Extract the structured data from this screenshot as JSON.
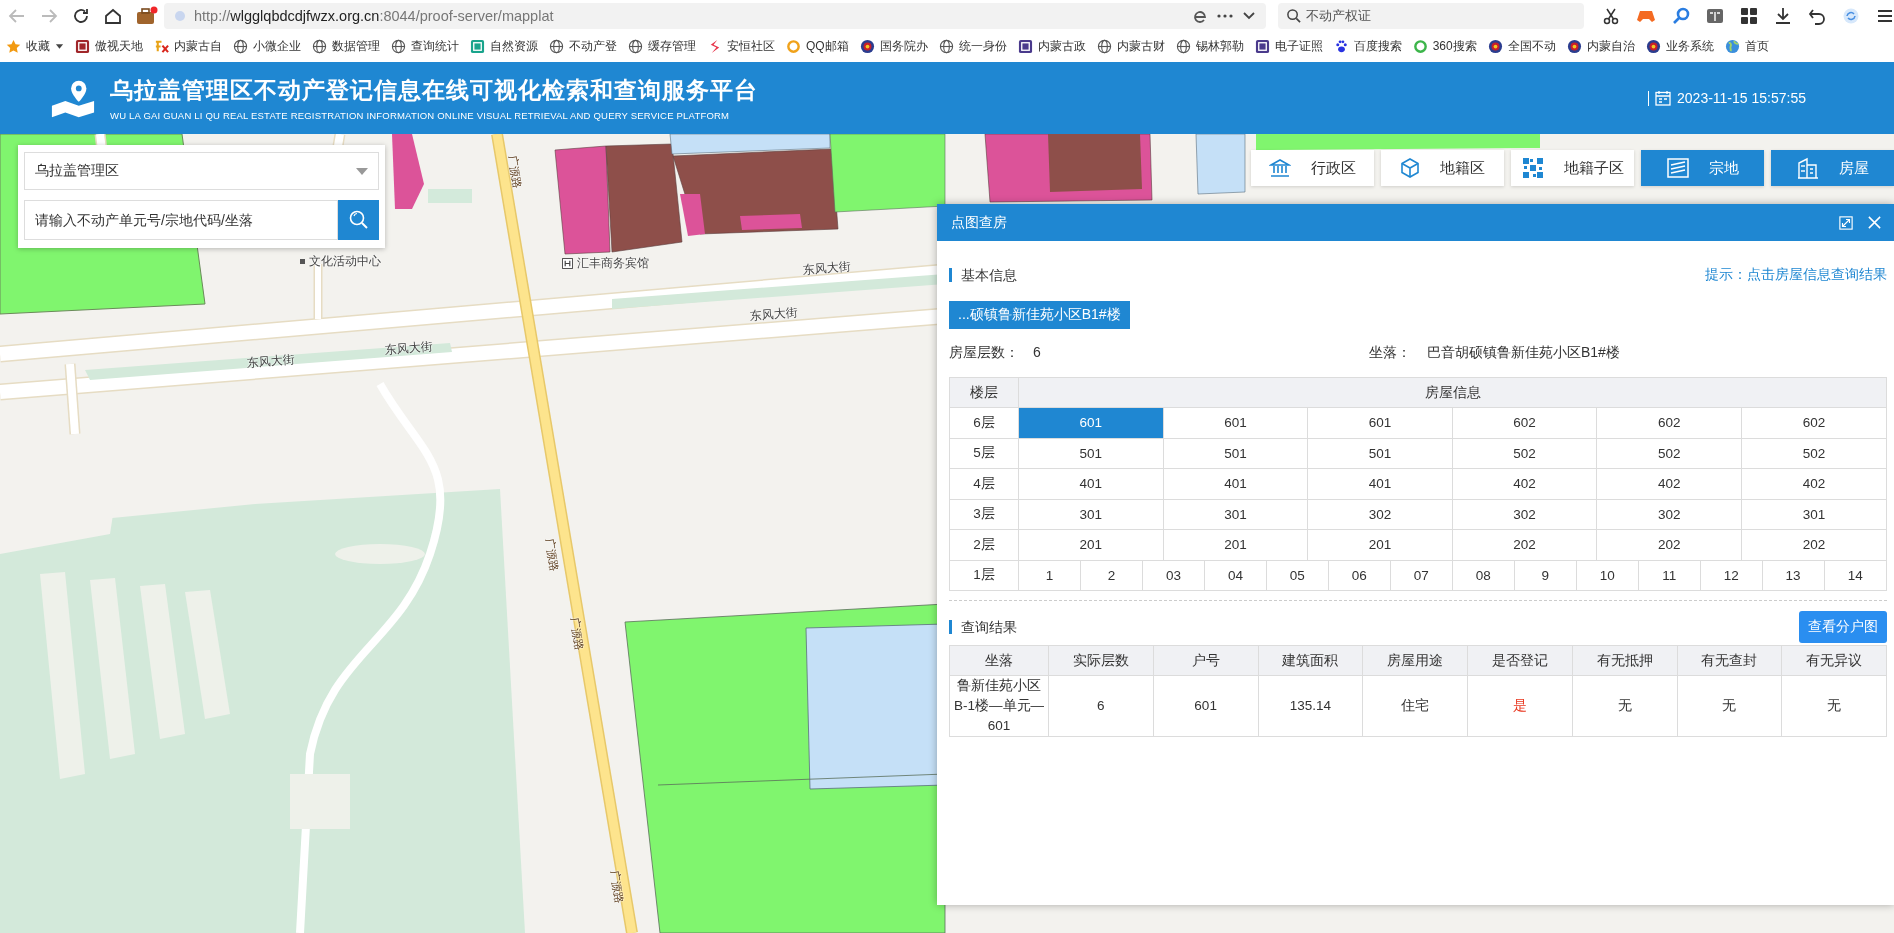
{
  "browser": {
    "url": "http://**wlgglqbdcdjfwzx.org.cn**:8044/proof-server/mapplat",
    "search_placeholder": "不动产权证",
    "bookmarks": [
      {
        "label": "收藏",
        "kind": "star"
      },
      {
        "label": "傲视天地",
        "kind": "tile",
        "color": "#a0262a"
      },
      {
        "label": "内蒙古自",
        "kind": "fx"
      },
      {
        "label": "小微企业",
        "kind": "globe"
      },
      {
        "label": "数据管理",
        "kind": "globe"
      },
      {
        "label": "查询统计",
        "kind": "globe"
      },
      {
        "label": "自然资源",
        "kind": "tile",
        "color": "#19a48c"
      },
      {
        "label": "不动产登",
        "kind": "globe"
      },
      {
        "label": "缓存管理",
        "kind": "globe"
      },
      {
        "label": "安恒社区",
        "kind": "swoosh"
      },
      {
        "label": "QQ邮箱",
        "kind": "ring",
        "color": "#f0a21b"
      },
      {
        "label": "国务院办",
        "kind": "emblem"
      },
      {
        "label": "统一身份",
        "kind": "globe"
      },
      {
        "label": "内蒙古政",
        "kind": "tile",
        "color": "#4a3a8c"
      },
      {
        "label": "内蒙古财",
        "kind": "globe"
      },
      {
        "label": "锡林郭勒",
        "kind": "globe"
      },
      {
        "label": "电子证照",
        "kind": "tile",
        "color": "#4a3a8c"
      },
      {
        "label": "百度搜索",
        "kind": "paw"
      },
      {
        "label": "360搜索",
        "kind": "ring",
        "color": "#3cb54a"
      },
      {
        "label": "全国不动",
        "kind": "emblem"
      },
      {
        "label": "内蒙自治",
        "kind": "emblem"
      },
      {
        "label": "业务系统",
        "kind": "emblem"
      },
      {
        "label": "首页",
        "kind": "earth"
      }
    ]
  },
  "header": {
    "title": "乌拉盖管理区不动产登记信息在线可视化检索和查询服务平台",
    "subtitle": "WU LA GAI GUAN LI QU REAL ESTATE REGISTRATION INFORMATION ONLINE VISUAL RETRIEVAL AND QUERY SERVICE PLATFORM",
    "datetime": "2023-11-15 15:57:55"
  },
  "search_panel": {
    "district": "乌拉盖管理区",
    "placeholder": "请输入不动产单元号/宗地代码/坐落"
  },
  "layers": [
    {
      "label": "行政区",
      "kind": "bank",
      "on": false
    },
    {
      "label": "地籍区",
      "kind": "cube",
      "on": false
    },
    {
      "label": "地籍子区",
      "kind": "mosaic",
      "on": false
    },
    {
      "label": "宗地",
      "kind": "parcel",
      "on": true
    },
    {
      "label": "房屋",
      "kind": "building",
      "on": true
    }
  ],
  "map": {
    "labels": [
      {
        "text": "文化活动中心",
        "kind": "poi"
      },
      {
        "text": "汇丰商务宾馆",
        "kind": "hotel"
      },
      {
        "text": "东风大街",
        "kind": "road"
      },
      {
        "text": "东风大街",
        "kind": "road"
      },
      {
        "text": "东风大街",
        "kind": "road"
      },
      {
        "text": "东风大街",
        "kind": "road"
      },
      {
        "text": "广源路",
        "kind": "road-vertical"
      },
      {
        "text": "广源路",
        "kind": "road-vertical"
      },
      {
        "text": "广源路",
        "kind": "road-vertical"
      },
      {
        "text": "广源路",
        "kind": "road-vertical"
      }
    ]
  },
  "popup": {
    "title": "点图查房",
    "basic": {
      "heading": "基本信息",
      "hint": "提示：点击房屋信息查询结果",
      "building_tab": "...硕镇鲁新佳苑小区B1#楼",
      "floors_label": "房屋层数：",
      "floors_value": "6",
      "location_label": "坐落：",
      "location_value": "巴音胡硕镇鲁新佳苑小区B1#楼"
    },
    "floor_table": {
      "columns": [
        "楼层",
        "房屋信息"
      ],
      "rows": [
        {
          "floor": "6层",
          "units": [
            {
              "text": "601",
              "selected": true
            },
            {
              "text": "601",
              "selected": false
            },
            {
              "text": "601",
              "selected": false
            },
            {
              "text": "602",
              "selected": false
            },
            {
              "text": "602",
              "selected": false
            },
            {
              "text": "602",
              "selected": false
            }
          ]
        },
        {
          "floor": "5层",
          "units": [
            {
              "text": "501",
              "selected": false
            },
            {
              "text": "501",
              "selected": false
            },
            {
              "text": "501",
              "selected": false
            },
            {
              "text": "502",
              "selected": false
            },
            {
              "text": "502",
              "selected": false
            },
            {
              "text": "502",
              "selected": false
            }
          ]
        },
        {
          "floor": "4层",
          "units": [
            {
              "text": "401",
              "selected": false
            },
            {
              "text": "401",
              "selected": false
            },
            {
              "text": "401",
              "selected": false
            },
            {
              "text": "402",
              "selected": false
            },
            {
              "text": "402",
              "selected": false
            },
            {
              "text": "402",
              "selected": false
            }
          ]
        },
        {
          "floor": "3层",
          "units": [
            {
              "text": "301",
              "selected": false
            },
            {
              "text": "301",
              "selected": false
            },
            {
              "text": "302",
              "selected": false
            },
            {
              "text": "302",
              "selected": false
            },
            {
              "text": "302",
              "selected": false
            },
            {
              "text": "301",
              "selected": false
            }
          ]
        },
        {
          "floor": "2层",
          "units": [
            {
              "text": "201",
              "selected": false
            },
            {
              "text": "201",
              "selected": false
            },
            {
              "text": "201",
              "selected": false
            },
            {
              "text": "202",
              "selected": false
            },
            {
              "text": "202",
              "selected": false
            },
            {
              "text": "202",
              "selected": false
            }
          ]
        },
        {
          "floor": "1层",
          "units": [
            {
              "text": "1",
              "selected": false
            },
            {
              "text": "2",
              "selected": false
            },
            {
              "text": "03",
              "selected": false
            },
            {
              "text": "04",
              "selected": false
            },
            {
              "text": "05",
              "selected": false
            },
            {
              "text": "06",
              "selected": false
            },
            {
              "text": "07",
              "selected": false
            },
            {
              "text": "08",
              "selected": false
            },
            {
              "text": "9",
              "selected": false
            },
            {
              "text": "10",
              "selected": false
            },
            {
              "text": "11",
              "selected": false
            },
            {
              "text": "12",
              "selected": false
            },
            {
              "text": "13",
              "selected": false
            },
            {
              "text": "14",
              "selected": false
            }
          ]
        }
      ]
    },
    "results": {
      "heading": "查询结果",
      "button": "查看分户图",
      "columns": [
        "坐落",
        "实际层数",
        "户号",
        "建筑面积",
        "房屋用途",
        "是否登记",
        "有无抵押",
        "有无查封",
        "有无异议"
      ],
      "rows": [
        {
          "cells": [
            {
              "text": "鲁新佳苑小区B-1楼—单元—601",
              "alert": false
            },
            {
              "text": "6",
              "alert": false
            },
            {
              "text": "601",
              "alert": false
            },
            {
              "text": "135.14",
              "alert": false
            },
            {
              "text": "住宅",
              "alert": false
            },
            {
              "text": "是",
              "alert": true
            },
            {
              "text": "无",
              "alert": false
            },
            {
              "text": "无",
              "alert": false
            },
            {
              "text": "无",
              "alert": false
            }
          ]
        }
      ]
    }
  }
}
